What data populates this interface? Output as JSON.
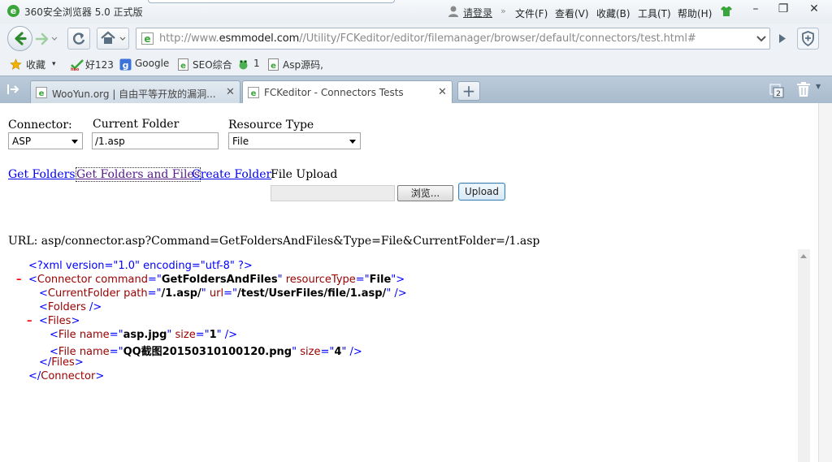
{
  "window": {
    "title": "360安全浏览器 5.0 正式版",
    "login_label": "请登录",
    "menu": [
      "文件(F)",
      "查看(V)",
      "收藏(B)",
      "工具(T)",
      "帮助(H)"
    ],
    "controls": {
      "minimize": "–",
      "restore": "❐",
      "close": "✕"
    }
  },
  "nav": {
    "url_prefix": "http://www.",
    "url_host": "esmmodel.com",
    "url_path": "//Utility/FCKeditor/editor/filemanager/browser/default/connectors/test.html#"
  },
  "bookmarks": [
    "收藏",
    "好123",
    "Google",
    "SEO综合",
    "1",
    "Asp源码,"
  ],
  "tabs": [
    {
      "label": "WooYun.org | 自由平等开放的漏洞...",
      "active": false
    },
    {
      "label": "FCKeditor - Connectors Tests",
      "active": true
    }
  ],
  "tab_count": "2",
  "page": {
    "connector_label": "Connector:",
    "connector_value": "ASP",
    "folder_label": "Current Folder",
    "folder_value": "/1.asp",
    "resource_label": "Resource Type",
    "resource_value": "File",
    "link_get_folders": "Get Folders",
    "link_get_folders_files": "Get Folders and Files",
    "link_create_folder": "Create Folder",
    "file_upload_label": "File Upload",
    "browse_label": "浏览...",
    "upload_label": "Upload",
    "url_text": "URL: asp/connector.asp?Command=GetFoldersAndFiles&Type=File&CurrentFolder=/1.asp"
  },
  "xml": {
    "pi": "<?xml version=\"1.0\" encoding=\"utf-8\" ?>",
    "connector_command": "GetFoldersAndFiles",
    "connector_resource": "File",
    "current_folder_path": "/1.asp/",
    "current_folder_url": "/test/UserFiles/file/1.asp/",
    "files": [
      {
        "name": "asp.jpg",
        "size": "1"
      },
      {
        "name": "QQ截图20150310100120.png",
        "size": "4"
      }
    ],
    "collapse_marker": "–"
  },
  "colors": {
    "xml_tag": "#990000",
    "xml_punct": "#0000ff",
    "link": "#0000ee",
    "link_visited": "#551a8b"
  }
}
